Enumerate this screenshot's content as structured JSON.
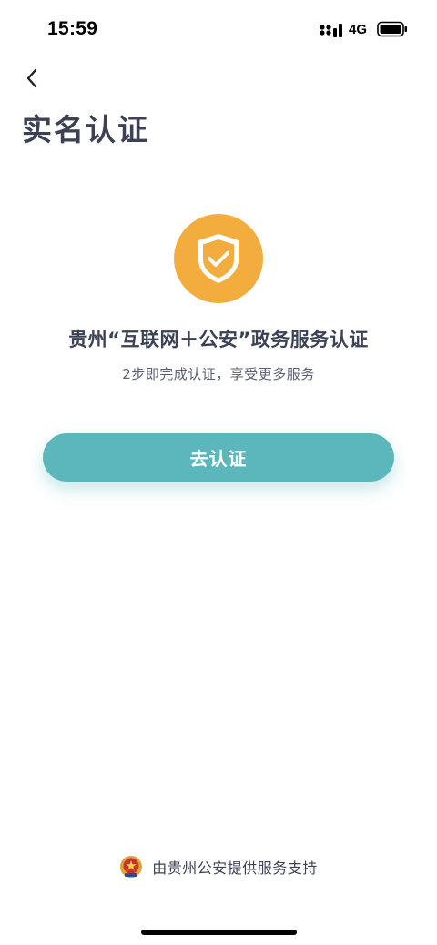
{
  "status_bar": {
    "time": "15:59",
    "network": "4G",
    "icons": [
      "signal-icon",
      "battery-icon"
    ]
  },
  "nav": {
    "back_icon": "chevron-left-icon",
    "title": "实名认证"
  },
  "hero": {
    "icon": "shield-check-icon",
    "headline": "贵州“互联网＋公安”政务服务认证",
    "subline": "2步即完成认证，享受更多服务"
  },
  "actions": {
    "verify_label": "去认证"
  },
  "footer": {
    "emblem_icon": "police-emblem-icon",
    "text": "由贵州公安提供服务支持"
  },
  "colors": {
    "accent": "#5bb7bc",
    "shield": "#f2ad3e",
    "title_text": "#3b4255"
  }
}
